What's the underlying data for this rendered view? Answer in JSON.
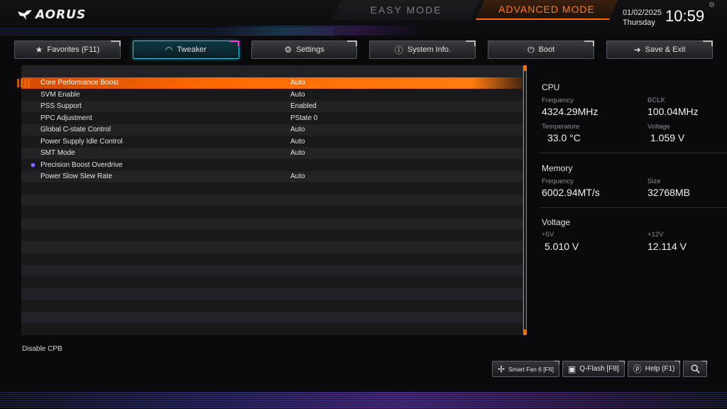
{
  "header": {
    "logo": "AORUS",
    "easy_mode": "EASY MODE",
    "advanced_mode": "ADVANCED MODE",
    "date": "01/02/2025",
    "day": "Thursday",
    "time": "10:59"
  },
  "tabs": [
    {
      "label": "Favorites (F11)",
      "icon": "star-folder-icon"
    },
    {
      "label": "Tweaker",
      "icon": "gauge-icon",
      "active": true
    },
    {
      "label": "Settings",
      "icon": "gear-icon"
    },
    {
      "label": "System Info.",
      "icon": "info-icon"
    },
    {
      "label": "Boot",
      "icon": "power-icon"
    },
    {
      "label": "Save & Exit",
      "icon": "exit-icon"
    }
  ],
  "settings": [
    {
      "name": "Core Performance Boost",
      "value": "Auto",
      "selected": true
    },
    {
      "name": "SVM Enable",
      "value": "Auto"
    },
    {
      "name": "PSS Support",
      "value": "Enabled"
    },
    {
      "name": "PPC Adjustment",
      "value": "PState 0"
    },
    {
      "name": "Global C-state Control",
      "value": "Auto"
    },
    {
      "name": "Power Supply Idle Control",
      "value": "Auto"
    },
    {
      "name": "SMT Mode",
      "value": "Auto"
    },
    {
      "name": "Precision Boost Overdrive",
      "value": "",
      "submenu": true
    },
    {
      "name": "Power Slow Slew Rate",
      "value": "Auto"
    }
  ],
  "panel": {
    "cpu": {
      "title": "CPU",
      "frequency_label": "Frequency",
      "frequency": "4324.29MHz",
      "bclk_label": "BCLK",
      "bclk": "100.04MHz",
      "temperature_label": "Temperature",
      "temperature": "33.0 °C",
      "voltage_label": "Voltage",
      "voltage": "1.059 V"
    },
    "memory": {
      "title": "Memory",
      "frequency_label": "Frequency",
      "frequency": "6002.94MT/s",
      "size_label": "Size",
      "size": "32768MB"
    },
    "voltage": {
      "title": "Voltage",
      "v5_label": "+5V",
      "v5": "5.010 V",
      "v12_label": "+12V",
      "v12": "12.114 V"
    }
  },
  "help_text": "Disable CPB",
  "bottom_buttons": [
    {
      "label": "Smart Fan 6 [F6]",
      "icon": "fan-icon"
    },
    {
      "label": "Q-Flash [F8]",
      "icon": "chip-icon"
    },
    {
      "label": "Help (F1)",
      "icon": "help-icon"
    },
    {
      "label": "",
      "icon": "search-icon"
    }
  ]
}
